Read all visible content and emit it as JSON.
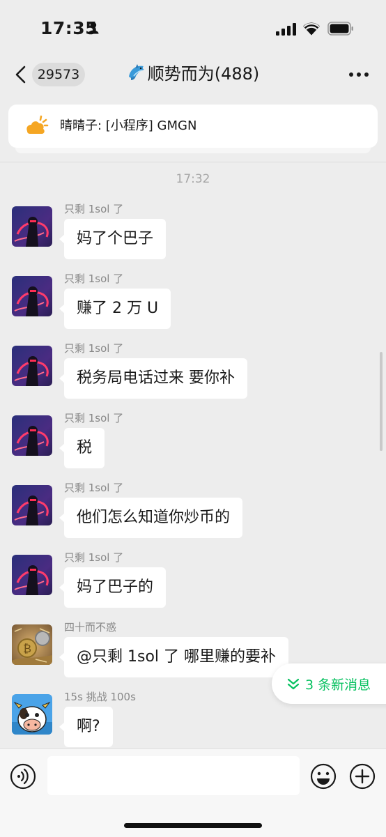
{
  "status_bar": {
    "time": "17:35",
    "icons": [
      "person-icon",
      "signal-icon",
      "wifi-icon",
      "battery-icon"
    ]
  },
  "nav": {
    "back_icon": "chevron-left-icon",
    "unread_count": "29573",
    "title_emoji": "dolphin-icon",
    "title": "顺势而为(488)",
    "more_icon": "more-icon"
  },
  "pinned": {
    "icon": "sun-icon",
    "text": "晴晴子: [小程序] GMGN"
  },
  "timestamp": "17:32",
  "messages": [
    {
      "sender": "只剩 1sol 了",
      "text": "妈了个巴子",
      "avatar": "neon-portrait"
    },
    {
      "sender": "只剩 1sol 了",
      "text": "赚了 2 万 U",
      "avatar": "neon-portrait"
    },
    {
      "sender": "只剩 1sol 了",
      "text": "税务局电话过来 要你补",
      "avatar": "neon-portrait"
    },
    {
      "sender": "只剩 1sol 了",
      "text": "税",
      "avatar": "neon-portrait"
    },
    {
      "sender": "只剩 1sol 了",
      "text": "他们怎么知道你炒币的",
      "avatar": "neon-portrait"
    },
    {
      "sender": "只剩 1sol 了",
      "text": "妈了巴子的",
      "avatar": "neon-portrait"
    },
    {
      "sender": "四十而不惑",
      "text": "@只剩 1sol 了 哪里赚的要补",
      "avatar": "bitcoin-coins"
    },
    {
      "sender": "15s 挑战 100s",
      "text": "啊?",
      "avatar": "cartoon-cow"
    }
  ],
  "new_messages": {
    "label": "3 条新消息",
    "icon": "chevron-double-down-icon",
    "color": "#07c160"
  },
  "input_bar": {
    "value": "",
    "icons": [
      "voice-icon",
      "emoji-icon",
      "plus-icon"
    ]
  },
  "colors": {
    "background": "#ededed",
    "bubble": "#ffffff",
    "accent": "#07c160"
  }
}
